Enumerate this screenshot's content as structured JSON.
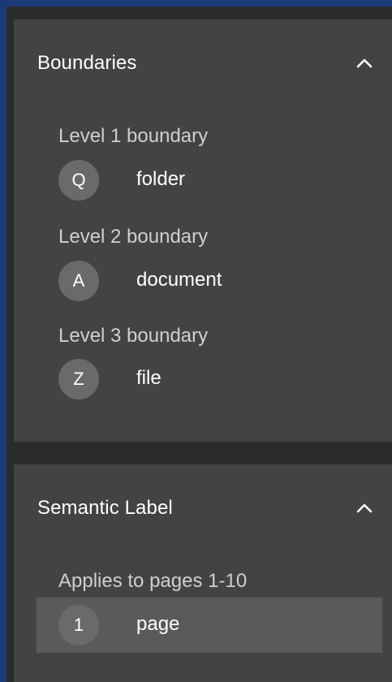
{
  "boundaries": {
    "title": "Boundaries",
    "levels": [
      {
        "label": "Level 1 boundary",
        "letter": "Q",
        "value": "folder"
      },
      {
        "label": "Level 2 boundary",
        "letter": "A",
        "value": "document"
      },
      {
        "label": "Level 3 boundary",
        "letter": "Z",
        "value": "file"
      }
    ]
  },
  "semantic_label": {
    "title": "Semantic Label",
    "applies_to": "Applies to pages 1-10",
    "item": {
      "letter": "1",
      "value": "page"
    }
  },
  "icons": {
    "collapse": "chevron-up-icon"
  },
  "colors": {
    "background": "#1b3a7a",
    "panel": "#434343",
    "selected_row": "#5a5a5a",
    "avatar": "#6a6a6a"
  }
}
